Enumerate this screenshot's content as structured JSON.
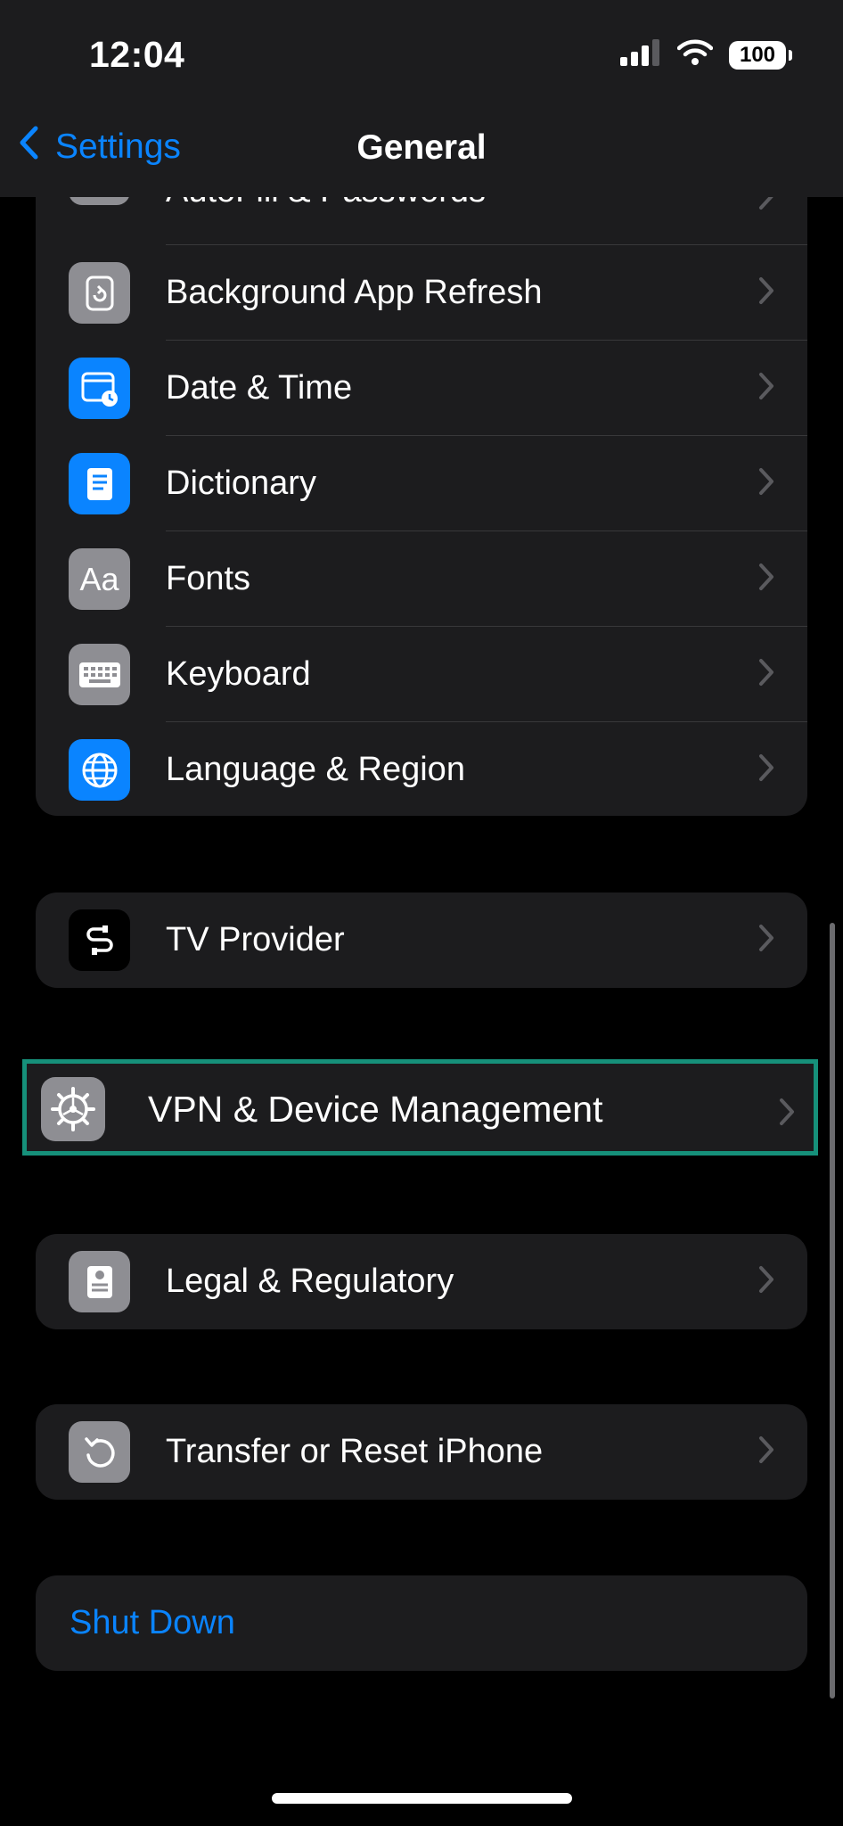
{
  "status_bar": {
    "time": "12:04",
    "battery": "100"
  },
  "nav": {
    "back_label": "Settings",
    "title": "General"
  },
  "group1": {
    "items": [
      {
        "label": "AutoFill & Passwords"
      },
      {
        "label": "Background App Refresh"
      },
      {
        "label": "Date & Time"
      },
      {
        "label": "Dictionary"
      },
      {
        "label": "Fonts",
        "icon_text": "Aa"
      },
      {
        "label": "Keyboard"
      },
      {
        "label": "Language & Region"
      }
    ]
  },
  "group2": {
    "items": [
      {
        "label": "TV Provider"
      }
    ]
  },
  "group3": {
    "items": [
      {
        "label": "VPN & Device Management"
      }
    ]
  },
  "group4": {
    "items": [
      {
        "label": "Legal & Regulatory"
      }
    ]
  },
  "group5": {
    "items": [
      {
        "label": "Transfer or Reset iPhone"
      }
    ]
  },
  "group6": {
    "items": [
      {
        "label": "Shut Down"
      }
    ]
  },
  "colors": {
    "accent": "#0a84ff",
    "highlight_border": "#16907a",
    "cell_bg": "#1c1c1e"
  }
}
